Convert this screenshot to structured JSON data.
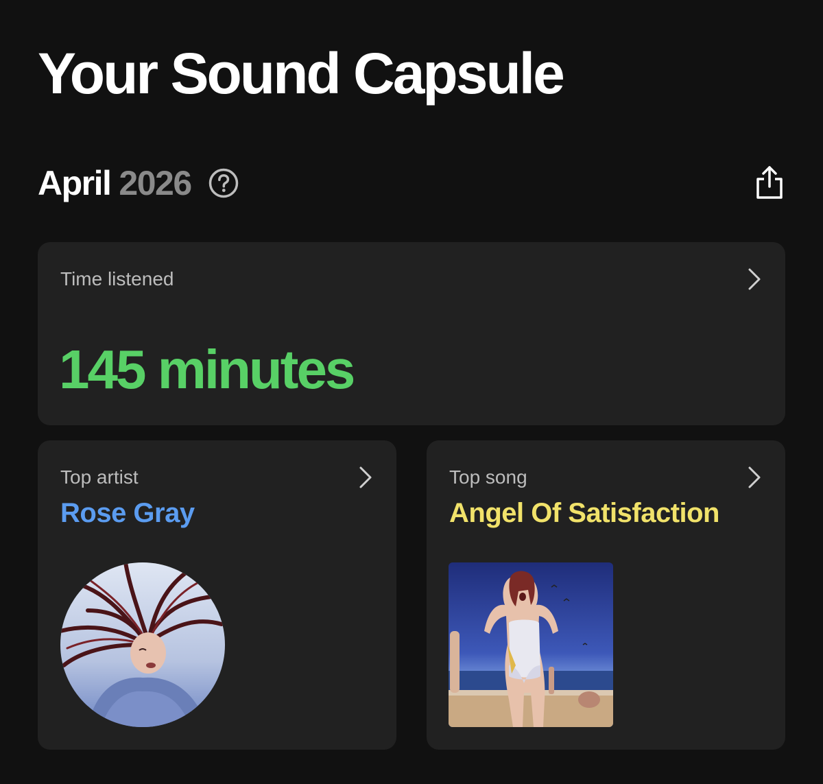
{
  "header": {
    "title": "Your Sound Capsule"
  },
  "period": {
    "month": "April",
    "year": "2026",
    "help_icon": "help-circle-icon",
    "share_icon": "share-icon"
  },
  "cards": {
    "time_listened": {
      "label": "Time listened",
      "value": "145 minutes",
      "accent_color": "#58d066"
    },
    "top_artist": {
      "label": "Top artist",
      "name": "Rose Gray",
      "accent_color": "#5b9cf0",
      "image": "artist-photo"
    },
    "top_song": {
      "label": "Top song",
      "name": "Angel Of Satisfaction",
      "accent_color": "#f1e26a",
      "image": "album-cover"
    }
  }
}
